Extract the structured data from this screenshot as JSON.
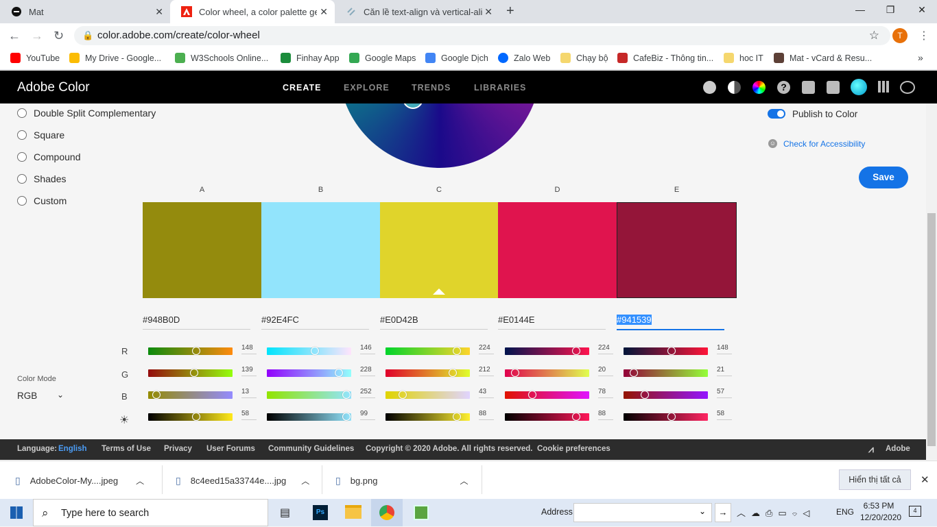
{
  "browser": {
    "tabs": [
      {
        "title": "Mat"
      },
      {
        "title": "Color wheel, a color palette gene"
      },
      {
        "title": "Căn lề text-align và vertical-align"
      }
    ],
    "url": "color.adobe.com/create/color-wheel",
    "profile_initial": "T",
    "bookmarks": [
      {
        "label": "YouTube",
        "color": "#ff0000"
      },
      {
        "label": "My Drive - Google...",
        "color": "#fbbc04"
      },
      {
        "label": "W3Schools Online...",
        "color": "#4caf50"
      },
      {
        "label": "Finhay App",
        "color": "#1b8c3c"
      },
      {
        "label": "Google Maps",
        "color": "#34a853"
      },
      {
        "label": "Google Dịch",
        "color": "#4285f4"
      },
      {
        "label": "Zalo Web",
        "color": "#0068ff"
      },
      {
        "label": "Chạy bộ",
        "color": "#f5d76e"
      },
      {
        "label": "CafeBiz - Thông tin...",
        "color": "#c62828"
      },
      {
        "label": "hoc IT",
        "color": "#f5d76e"
      },
      {
        "label": "Mat - vCard & Resu...",
        "color": "#5d4037"
      }
    ]
  },
  "adobe": {
    "logo": "Adobe Color",
    "nav": [
      "CREATE",
      "EXPLORE",
      "TRENDS",
      "LIBRARIES"
    ],
    "harmony_rules": [
      "Double Split Complementary",
      "Square",
      "Compound",
      "Shades",
      "Custom"
    ],
    "publish_label": "Publish to Color",
    "accessibility_label": "Check for Accessibility",
    "save_label": "Save",
    "color_mode_label": "Color Mode",
    "color_mode_value": "RGB",
    "row_labels": [
      "R",
      "G",
      "B"
    ],
    "swatches": [
      {
        "label": "A",
        "hex": "#948B0D",
        "color": "#948B0D",
        "r": 148,
        "g": 139,
        "b": 13,
        "brightness": 58
      },
      {
        "label": "B",
        "hex": "#92E4FC",
        "color": "#92E4FC",
        "r": 146,
        "g": 228,
        "b": 252,
        "brightness": 99
      },
      {
        "label": "C",
        "hex": "#E0D42B",
        "color": "#E0D42B",
        "r": 224,
        "g": 212,
        "b": 43,
        "brightness": 88
      },
      {
        "label": "D",
        "hex": "#E0144E",
        "color": "#E0144E",
        "r": 224,
        "g": 20,
        "b": 78,
        "brightness": 88
      },
      {
        "label": "E",
        "hex": "#941539",
        "color": "#941539",
        "r": 148,
        "g": 21,
        "b": 57,
        "brightness": 58
      }
    ]
  },
  "footer": {
    "language_label": "Language:",
    "language_value": "English",
    "links": [
      "Terms of Use",
      "Privacy",
      "User Forums",
      "Community Guidelines",
      "Copyright © 2020 Adobe. All rights reserved.",
      "Cookie preferences"
    ],
    "brand": "Adobe"
  },
  "downloads": {
    "items": [
      "AdobeColor-My....jpeg",
      "8c4eed15a33744e....jpg",
      "bg.png"
    ],
    "show_all": "Hiển thị tất cả"
  },
  "taskbar": {
    "search_placeholder": "Type here to search",
    "address_label": "Address",
    "lang": "ENG",
    "time": "6:53 PM",
    "date": "12/20/2020",
    "notifications": "4"
  }
}
